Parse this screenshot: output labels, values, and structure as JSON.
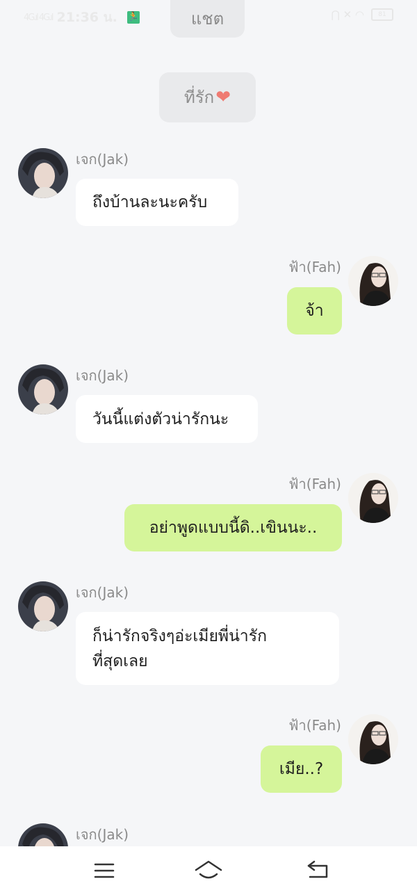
{
  "status_bar": {
    "signal": "4G.ıl 4G.ıl",
    "time": "21:36 น.",
    "app_badge": "🏃",
    "right_icons": "⋂ ✕ ◠",
    "battery": "81"
  },
  "top_pill": "แชต",
  "center_pill": {
    "text": "ที่รัก",
    "emoji": "❤"
  },
  "messages": [
    {
      "sender": "เจก(Jak)",
      "lines": [
        "ถึงบ้านละนะครับ"
      ]
    },
    {
      "sender": "ฟ้า(Fah)",
      "lines": [
        "จ้า"
      ]
    },
    {
      "sender": "เจก(Jak)",
      "lines": [
        "วันนี้แต่งตัวน่ารักนะ"
      ]
    },
    {
      "sender": "ฟ้า(Fah)",
      "lines": [
        "อย่าพูดแบบนี้ดิ..เขินนะ.."
      ]
    },
    {
      "sender": "เจก(Jak)",
      "lines": [
        "ก็น่ารักจริงๆอ่ะเมียพี่น่ารัก",
        "ที่สุดเลย"
      ]
    },
    {
      "sender": "ฟ้า(Fah)",
      "lines": [
        "เมีย..?"
      ]
    },
    {
      "sender": "เจก(Jak)",
      "lines": []
    }
  ],
  "nav": [
    "menu-icon",
    "home-icon",
    "back-icon"
  ]
}
